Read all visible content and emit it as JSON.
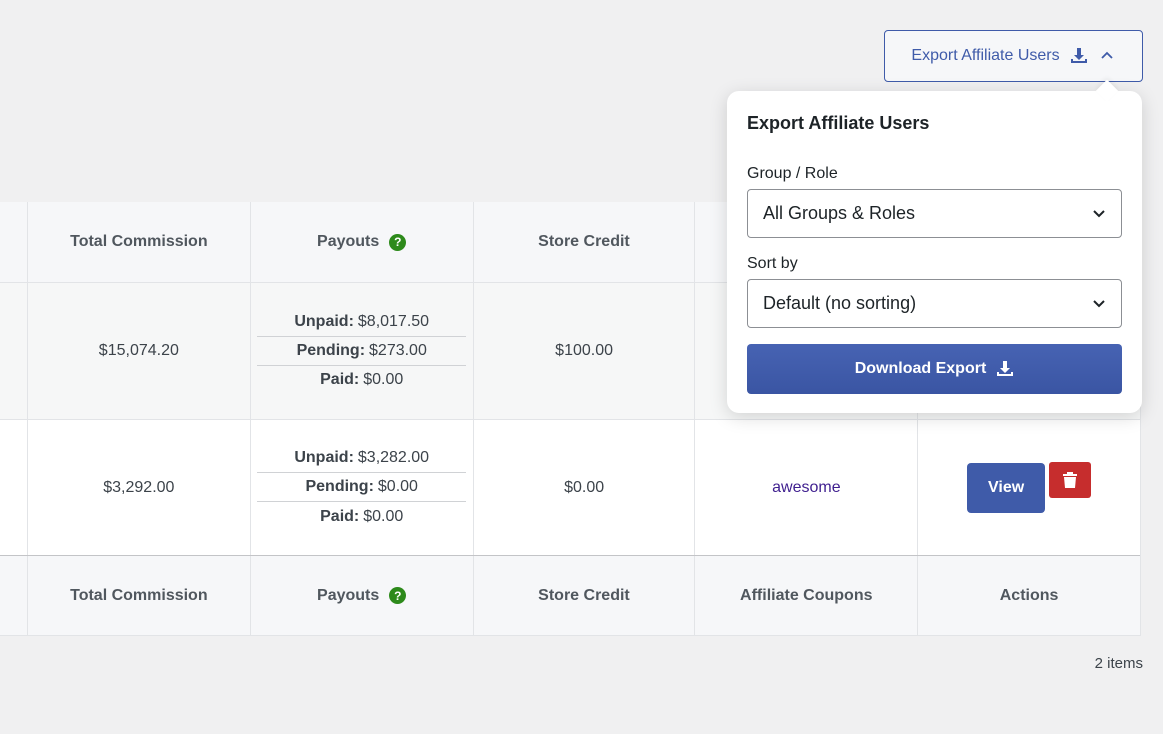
{
  "export_toggle": {
    "label": "Export Affiliate Users",
    "icon": "download-icon",
    "chevron": "chevron-up-icon"
  },
  "table": {
    "columns": [
      "Total Commission",
      "Payouts",
      "Store Credit",
      "Affiliate Coupons",
      "Actions"
    ],
    "rows": [
      {
        "total_commission": "$15,074.20",
        "payouts": {
          "unpaid_label": "Unpaid:",
          "unpaid": "$8,017.50",
          "pending_label": "Pending:",
          "pending": "$273.00",
          "paid_label": "Paid:",
          "paid": "$0.00"
        },
        "store_credit": "$100.00"
      },
      {
        "total_commission": "$3,292.00",
        "payouts": {
          "unpaid_label": "Unpaid:",
          "unpaid": "$3,282.00",
          "pending_label": "Pending:",
          "pending": "$0.00",
          "paid_label": "Paid:",
          "paid": "$0.00"
        },
        "store_credit": "$0.00",
        "coupon": "awesome",
        "view_label": "View"
      }
    ],
    "help_glyph": "?"
  },
  "items_count": "2 items",
  "popover": {
    "title": "Export Affiliate Users",
    "group_label": "Group / Role",
    "group_value": "All Groups & Roles",
    "sort_label": "Sort by",
    "sort_value": "Default (no sorting)",
    "download_label": "Download Export"
  },
  "colors": {
    "primary": "#3f5ba9",
    "danger": "#c62d2d",
    "help": "#2d8a1b"
  }
}
